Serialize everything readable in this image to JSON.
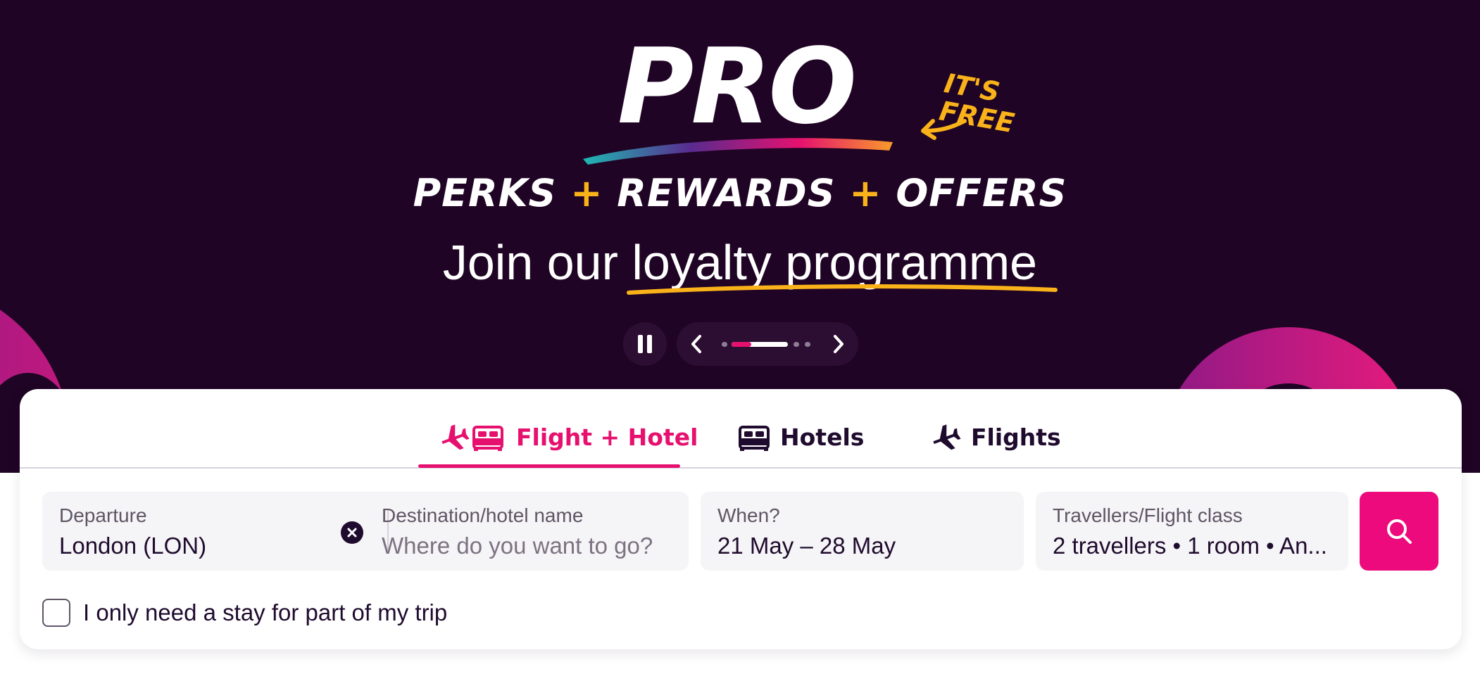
{
  "hero": {
    "logo_text": "PRO",
    "free_tag": "IT'S FREE",
    "tagline": {
      "part1": "PERKS",
      "plus": "+",
      "part2": "REWARDS",
      "part3": "OFFERS"
    },
    "join_prefix": "Join our",
    "join_highlight": "loyalty programme",
    "colors": {
      "background": "#200425",
      "accent_yellow": "#f9b21a",
      "accent_pink": "#e6116f"
    }
  },
  "carousel": {
    "pause_icon": "pause-icon",
    "prev_icon": "chevron-left-icon",
    "next_icon": "chevron-right-icon",
    "active_slide": 2,
    "slide_count": 5
  },
  "search": {
    "tabs": [
      {
        "label": "Flight + Hotel",
        "icon": "plane-bed-icon",
        "active": true
      },
      {
        "label": "Hotels",
        "icon": "bed-icon",
        "active": false
      },
      {
        "label": "Flights",
        "icon": "plane-icon",
        "active": false
      }
    ],
    "departure": {
      "label": "Departure",
      "value": "London (LON)"
    },
    "destination": {
      "label": "Destination/hotel name",
      "placeholder": "Where do you want to go?"
    },
    "when": {
      "label": "When?",
      "value": "21 May – 28 May"
    },
    "travellers": {
      "label": "Travellers/Flight class",
      "value": "2 travellers • 1 room • An..."
    },
    "search_icon": "search-icon",
    "partial_stay_label": "I only need a stay for part of my trip",
    "partial_stay_checked": false,
    "colors": {
      "primary": "#ec0a7c",
      "field_bg": "#f5f4f6"
    }
  }
}
